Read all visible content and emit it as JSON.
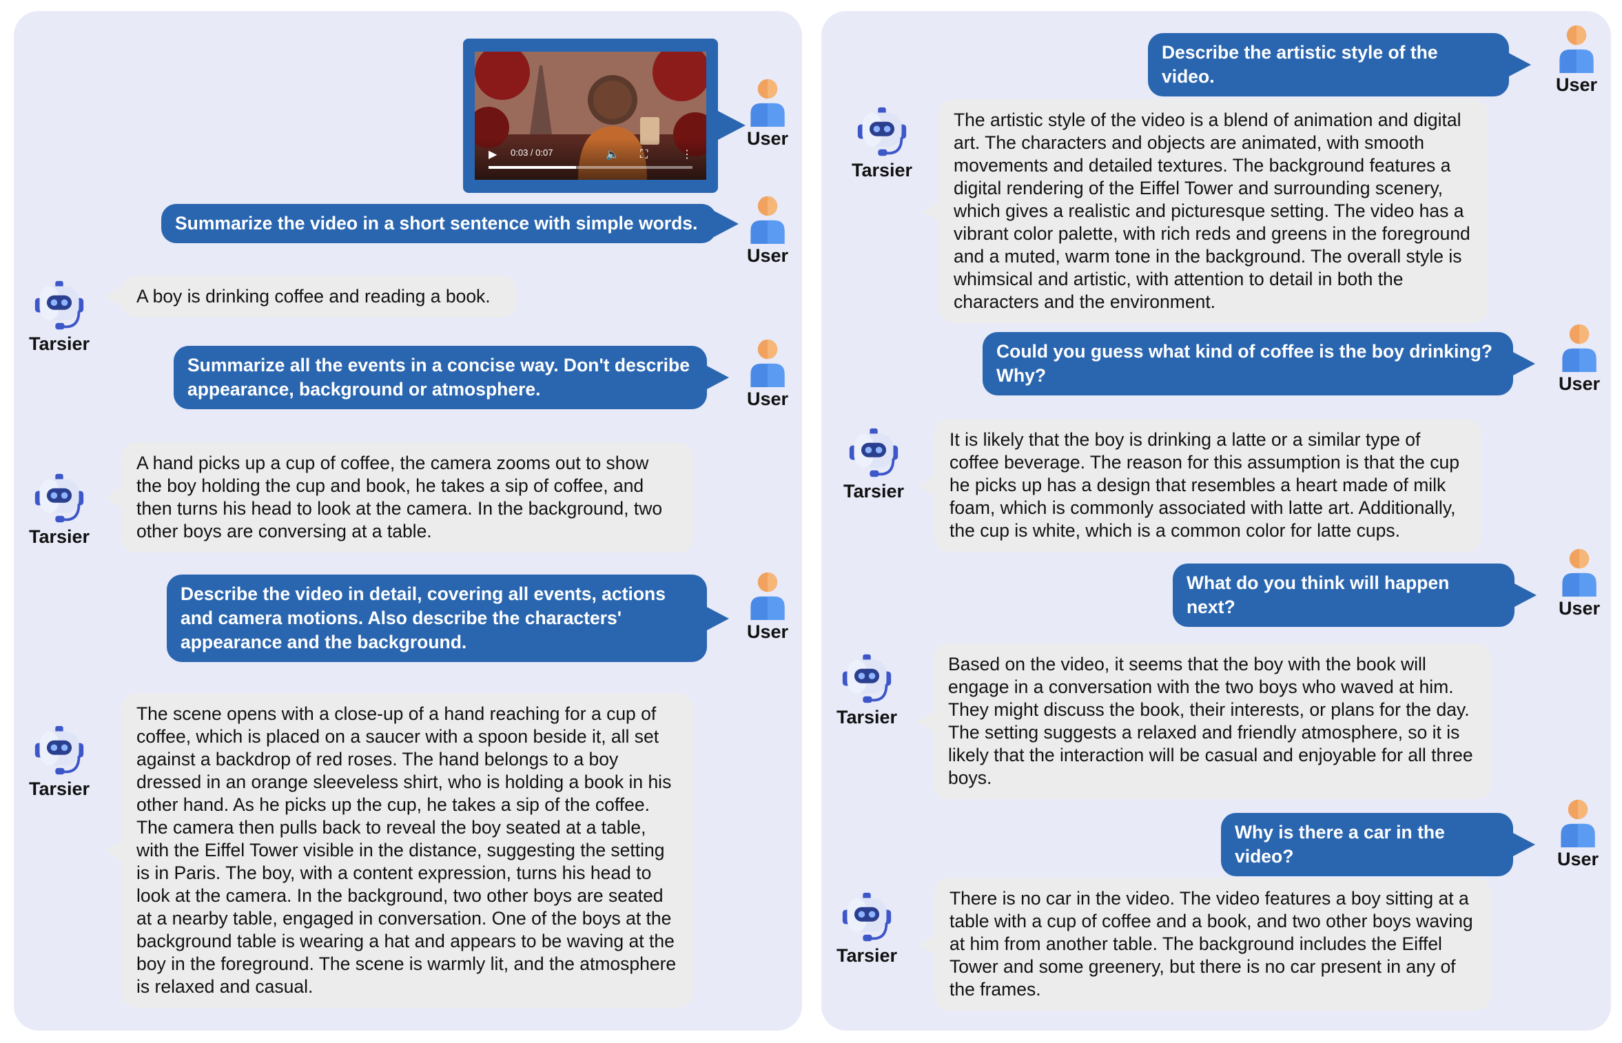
{
  "labels": {
    "user": "User",
    "bot": "Tarsier"
  },
  "video": {
    "time": "0:03 / 0:07",
    "progress": 0.43
  },
  "left": {
    "q1": "Summarize the video in a short sentence with simple words.",
    "a1": "A boy is drinking coffee and reading a book.",
    "q2": "Summarize all the events in a concise way. Don't describe appearance, background or atmosphere.",
    "a2": "A hand picks up a cup of coffee, the camera zooms out to show the boy holding the cup and book, he takes a sip of coffee, and then turns his head to look at the camera. In the background, two other boys are conversing at a table.",
    "q3": "Describe the video in detail, covering all events, actions and camera motions. Also describe the characters' appearance and the background.",
    "a3": "The scene opens with a close-up of a hand reaching for a cup of coffee, which is placed on a saucer with a spoon beside it, all set against a backdrop of red roses. The hand belongs to a boy dressed in an orange sleeveless shirt, who is holding a book in his other hand. As he picks up the cup, he takes a sip of the coffee. The camera then pulls back to reveal the boy seated at a table, with the Eiffel Tower visible in the distance, suggesting the setting is in Paris. The boy, with a content expression, turns his head to look at the camera. In the background, two other boys are seated at a nearby table, engaged in conversation. One of the boys at the background table is wearing a hat and appears to be waving at the boy in the foreground. The scene is warmly lit, and the atmosphere is relaxed and casual."
  },
  "right": {
    "q1": "Describe the artistic style of the video.",
    "a1": "The artistic style of the video is a blend of animation and digital art. The characters and objects are animated, with smooth movements and detailed textures. The background features a digital rendering of the Eiffel Tower and surrounding scenery, which gives a realistic and picturesque setting. The video has a vibrant color palette, with rich reds and greens in the foreground and a muted, warm tone in the background. The overall style is whimsical and artistic, with attention to detail in both the characters and the environment.",
    "q2": "Could you guess what kind of coffee is the boy drinking? Why?",
    "a2": "It is likely that the boy is drinking a latte or a similar type of coffee beverage. The reason for this assumption is that the cup he picks up has a design that resembles a heart made of milk foam, which is commonly associated with latte art. Additionally, the cup is white, which is a common color for latte cups.",
    "q3": "What do you think will happen next?",
    "a3": "Based on the video, it seems that the boy with the book will engage in a conversation with the two boys who waved at him. They might discuss the book, their interests, or plans for the day. The setting suggests a relaxed and friendly atmosphere, so it is likely that the interaction will be casual and enjoyable for all three boys.",
    "q4": "Why is there a car in the video?",
    "a4": "There is no car in the video. The video features a boy sitting at a table with a cup of coffee and a book, and two other boys waving at him from another table. The background includes the Eiffel Tower and some greenery, but there is no car present in any of the frames."
  }
}
